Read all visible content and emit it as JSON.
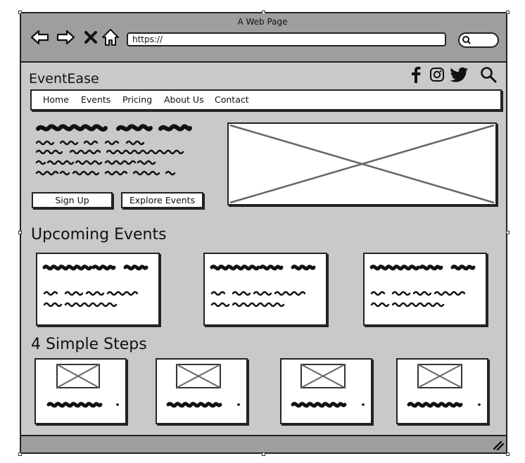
{
  "window": {
    "title": "A Web Page"
  },
  "browser": {
    "url": "https://",
    "nav_icons": [
      "back-arrow-icon",
      "forward-arrow-icon",
      "close-x-icon",
      "home-icon"
    ],
    "search_icon": "search-icon"
  },
  "site": {
    "brand": "EventEase",
    "social_icons": [
      "facebook-icon",
      "instagram-icon",
      "twitter-icon",
      "search-icon"
    ],
    "menu": [
      "Home",
      "Events",
      "Pricing",
      "About Us",
      "Contact"
    ]
  },
  "hero": {
    "buttons": {
      "signup": "Sign Up",
      "explore": "Explore Events"
    }
  },
  "sections": {
    "upcoming_title": "Upcoming Events",
    "steps_title": "4 Simple Steps"
  },
  "colors": {
    "chrome": "#9e9e9e",
    "page": "#c9c9c9",
    "ink": "#222222",
    "placeholder_x": "#666666"
  }
}
